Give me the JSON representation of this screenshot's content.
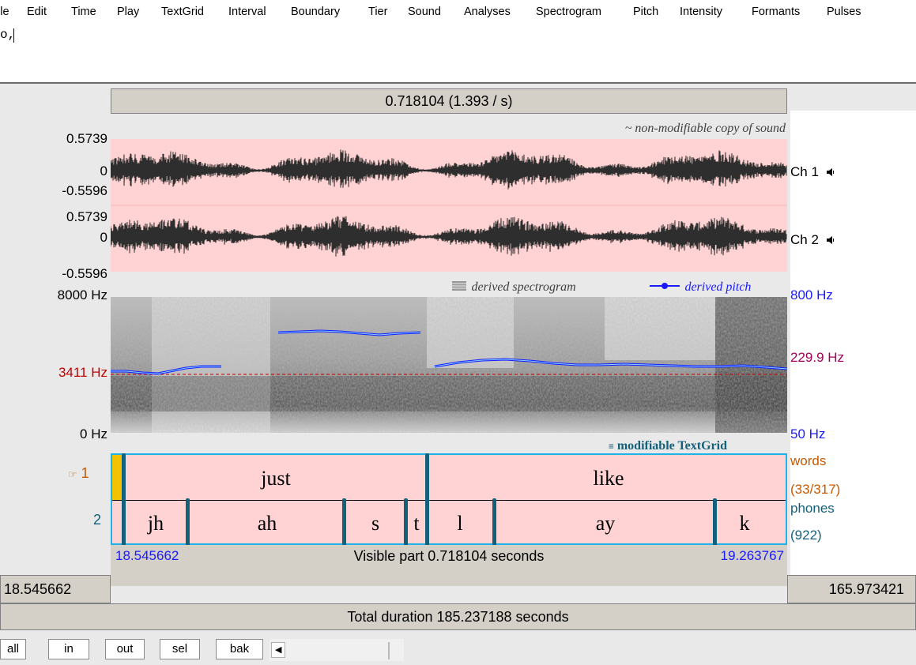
{
  "menu": [
    "ile",
    "Edit",
    "Time",
    "Play",
    "TextGrid",
    "Interval",
    "Boundary",
    "Tier",
    "Sound",
    "Analyses",
    "Spectrogram",
    "Pitch",
    "Intensity",
    "Formants",
    "Pulses"
  ],
  "text_area": {
    "value": "o,"
  },
  "selection_bar": {
    "label": "0.718104 (1.393 / s)"
  },
  "sound": {
    "note": "~ non-modifiable copy of sound",
    "ch1": {
      "max": "0.5739",
      "zero": "0",
      "min": "-0.5596",
      "label": "Ch 1"
    },
    "ch2": {
      "max": "0.5739",
      "zero": "0",
      "min": "-0.5596",
      "label": "Ch 2"
    },
    "speaker_icon": "speaker-icon"
  },
  "spectrogram": {
    "legend_spectro": "derived spectrogram",
    "legend_pitch": "derived pitch",
    "freq_top": "8000 Hz",
    "freq_cursor": "3411 Hz",
    "freq_bottom": "0 Hz",
    "pitch_top": "800 Hz",
    "pitch_cursor": "229.9 Hz",
    "pitch_bottom": "50 Hz",
    "pitch_color": "#1a1aff",
    "cursor_color": "#b40000"
  },
  "textgrid": {
    "note": "modifiable TextGrid",
    "tiers": [
      {
        "num": "1",
        "name": "words",
        "count": "(33/317)",
        "intervals": [
          "just",
          "like"
        ]
      },
      {
        "num": "2",
        "name": "phones",
        "count": "(922)",
        "intervals": [
          "jh",
          "ah",
          "s",
          "t",
          "l",
          "ay",
          "k"
        ]
      }
    ],
    "pointer_icon": "hand-pointer-icon",
    "boundary_color": "#12607a",
    "border_color": "#1fb2e6"
  },
  "bottom": {
    "visible_left": "18.545662",
    "visible_right": "19.263767",
    "visible_label": "Visible part 0.718104 seconds",
    "left_time": "18.545662",
    "right_time": "165.973421",
    "total": "Total duration 185.237188 seconds"
  },
  "buttons": [
    "all",
    "in",
    "out",
    "sel",
    "bak"
  ],
  "scroll_left_icon": "scroll-left-arrow-icon"
}
